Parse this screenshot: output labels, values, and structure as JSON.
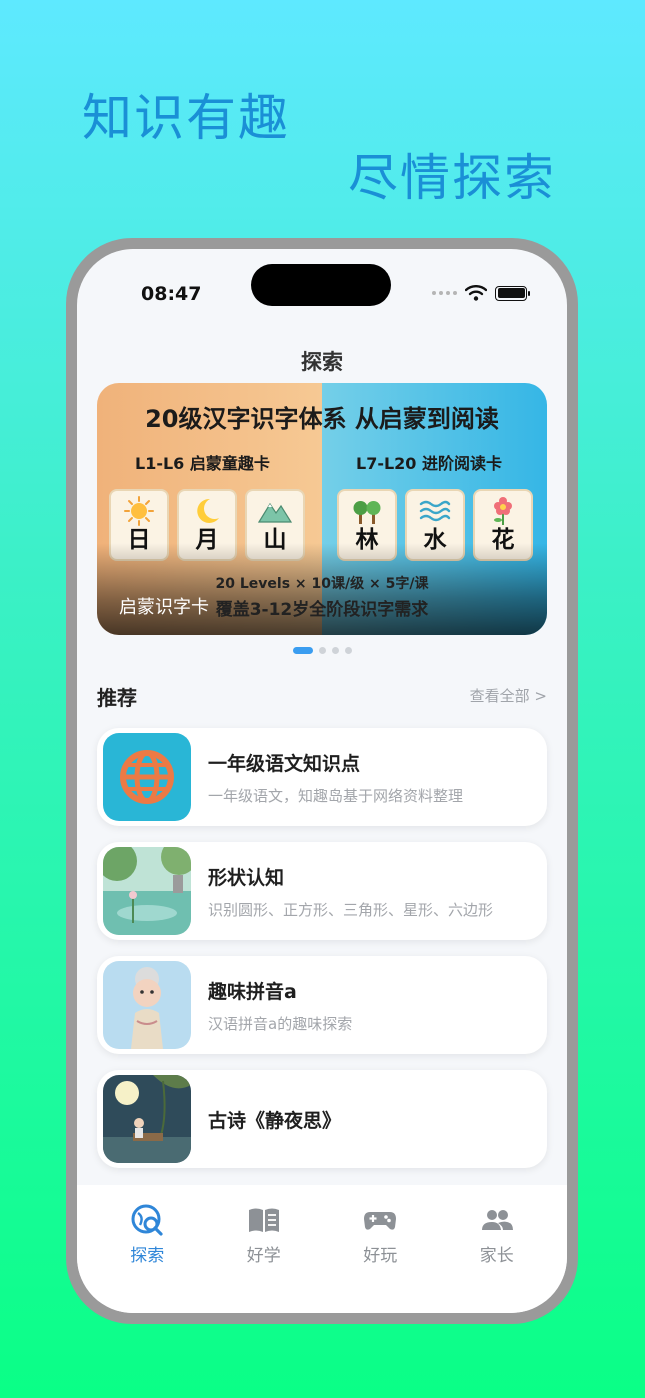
{
  "hero": {
    "line1": "知识有趣",
    "line2": "尽情探索"
  },
  "status": {
    "time": "08:47"
  },
  "nav": {
    "title": "探索"
  },
  "banner": {
    "headline": "20级汉字识字体系 从启蒙到阅读",
    "left_subtitle": "L1-L6 启蒙童趣卡",
    "right_subtitle": "L7-L20 进阶阅读卡",
    "cards_left": [
      {
        "char": "日",
        "icon": "sun-icon"
      },
      {
        "char": "月",
        "icon": "moon-icon"
      },
      {
        "char": "山",
        "icon": "mountain-icon"
      }
    ],
    "cards_right": [
      {
        "char": "林",
        "icon": "trees-icon"
      },
      {
        "char": "水",
        "icon": "water-icon"
      },
      {
        "char": "花",
        "icon": "flower-icon"
      }
    ],
    "stats": "20 Levels × 10课/级 × 5字/课",
    "cover": "覆盖3-12岁全阶段识字需求",
    "caption": "启蒙识字卡",
    "page_count": 4,
    "active_page": 0
  },
  "recommend": {
    "title": "推荐",
    "see_all": "查看全部 >",
    "items": [
      {
        "title": "一年级语文知识点",
        "desc": "一年级语文，知趣岛基于网络资料整理",
        "thumb": "globe-icon"
      },
      {
        "title": "形状认知",
        "desc": "识别圆形、正方形、三角形、星形、六边形",
        "thumb": "garden-scene"
      },
      {
        "title": "趣味拼音a",
        "desc": "汉语拼音a的趣味探索",
        "thumb": "grandma-figure"
      },
      {
        "title": "古诗《静夜思》",
        "desc": "",
        "thumb": "moonlit-night-scene"
      }
    ]
  },
  "tabs": [
    {
      "label": "探索",
      "icon": "explore-icon",
      "active": true
    },
    {
      "label": "好学",
      "icon": "book-icon",
      "active": false
    },
    {
      "label": "好玩",
      "icon": "gamepad-icon",
      "active": false
    },
    {
      "label": "家长",
      "icon": "parents-icon",
      "active": false
    }
  ],
  "colors": {
    "accent": "#2f86d8",
    "hero_text": "#1a8fd6",
    "inactive_tab": "#8d9196"
  }
}
